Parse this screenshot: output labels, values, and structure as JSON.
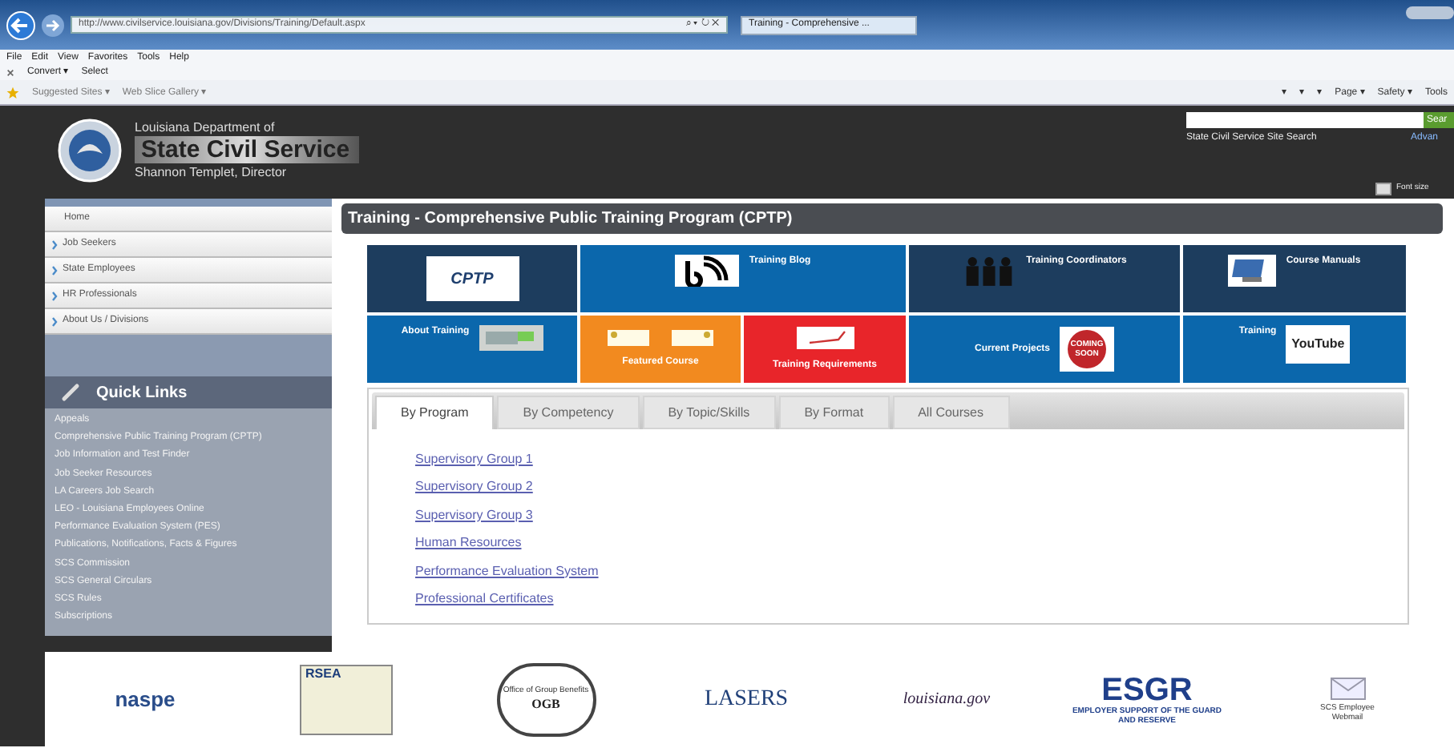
{
  "browser": {
    "url": "http://www.civilservice.louisiana.gov/Divisions/Training/Default.aspx",
    "address_icons": "⌕ ▾ ↻ ✕",
    "tab_title": "Training - Comprehensive ...",
    "menu": [
      "File",
      "Edit",
      "View",
      "Favorites",
      "Tools",
      "Help"
    ],
    "toolbar": [
      {
        "label": "Convert ▾"
      },
      {
        "label": "Select"
      }
    ],
    "favorites": [
      {
        "label": "Suggested Sites ▾"
      },
      {
        "label": "Web Slice Gallery ▾"
      }
    ],
    "command_bar": [
      "▾",
      "▾",
      "▾",
      "Page ▾",
      "Safety ▾",
      "Tools"
    ]
  },
  "header": {
    "kicker": "Louisiana Department of",
    "title": "State Civil Service",
    "subtitle": "Shannon Templet, Director",
    "search_button": "Sear",
    "search_caption": "State Civil Service Site Search",
    "advanced": "Advan",
    "font_size": "Font size"
  },
  "nav": [
    {
      "label": "Home",
      "arrow": false
    },
    {
      "label": "Job Seekers",
      "arrow": true
    },
    {
      "label": "State Employees",
      "arrow": true
    },
    {
      "label": "HR Professionals",
      "arrow": true
    },
    {
      "label": "About Us / Divisions",
      "arrow": true
    }
  ],
  "quick_links": {
    "title": "Quick Links",
    "links": [
      "Appeals",
      "Comprehensive Public Training Program (CPTP)",
      "Job Information and Test Finder",
      "Job Seeker Resources",
      "LA Careers Job Search",
      "LEO - Louisiana Employees Online",
      "Performance Evaluation System (PES)",
      "Publications, Notifications, Facts & Figures",
      "SCS Commission",
      "SCS General Circulars",
      "SCS Rules",
      "Subscriptions"
    ]
  },
  "page_title": "Training - Comprehensive Public Training Program (CPTP)",
  "tiles": [
    {
      "kind": "cptp",
      "color": "#1d3d5e",
      "badge": "CPTP"
    },
    {
      "kind": "blog",
      "color": "#0b67ac",
      "label": "Training Blog"
    },
    {
      "kind": "people",
      "color": "#1d3d5e",
      "label": "Training Coordinators"
    },
    {
      "kind": "manual",
      "color": "#1d3d5e",
      "label": "Course Manuals"
    },
    {
      "kind": "keyboard",
      "color": "#0b67ac",
      "label": "About Training"
    },
    {
      "kind": "featured",
      "color": "#f28a1f",
      "label": "Featured Course"
    },
    {
      "kind": "requirements",
      "color": "#e8252a",
      "label": "Training Requirements"
    },
    {
      "kind": "coming-soon",
      "color": "#0b67ac",
      "label": "Current Projects",
      "badge": "COMING SOON"
    },
    {
      "kind": "youtube",
      "color": "#0b67ac",
      "label": "Training",
      "badge": "YouTube"
    }
  ],
  "tabs": [
    {
      "label": "By Program",
      "selected": true
    },
    {
      "label": "By Competency",
      "selected": false
    },
    {
      "label": "By Topic/Skills",
      "selected": false
    },
    {
      "label": "By Format",
      "selected": false
    },
    {
      "label": "All Courses",
      "selected": false
    }
  ],
  "program_links": [
    "Supervisory Group 1",
    "Supervisory Group 2",
    "Supervisory Group 3",
    "Human Resources",
    "Performance Evaluation System",
    "Professional Certificates"
  ],
  "partners": [
    {
      "kind": "naspe",
      "text": "naspe"
    },
    {
      "kind": "rsea",
      "text": "RSEA"
    },
    {
      "kind": "ogb",
      "text": "OGB",
      "caption": "Office of Group Benefits"
    },
    {
      "kind": "lasers",
      "text": "LASERS"
    },
    {
      "kind": "lagov",
      "text": "louisiana.gov"
    },
    {
      "kind": "esgr",
      "text": "ESGR",
      "caption": "EMPLOYER SUPPORT OF THE GUARD AND RESERVE"
    },
    {
      "kind": "webmail",
      "text": "SCS Employee Webmail"
    }
  ]
}
